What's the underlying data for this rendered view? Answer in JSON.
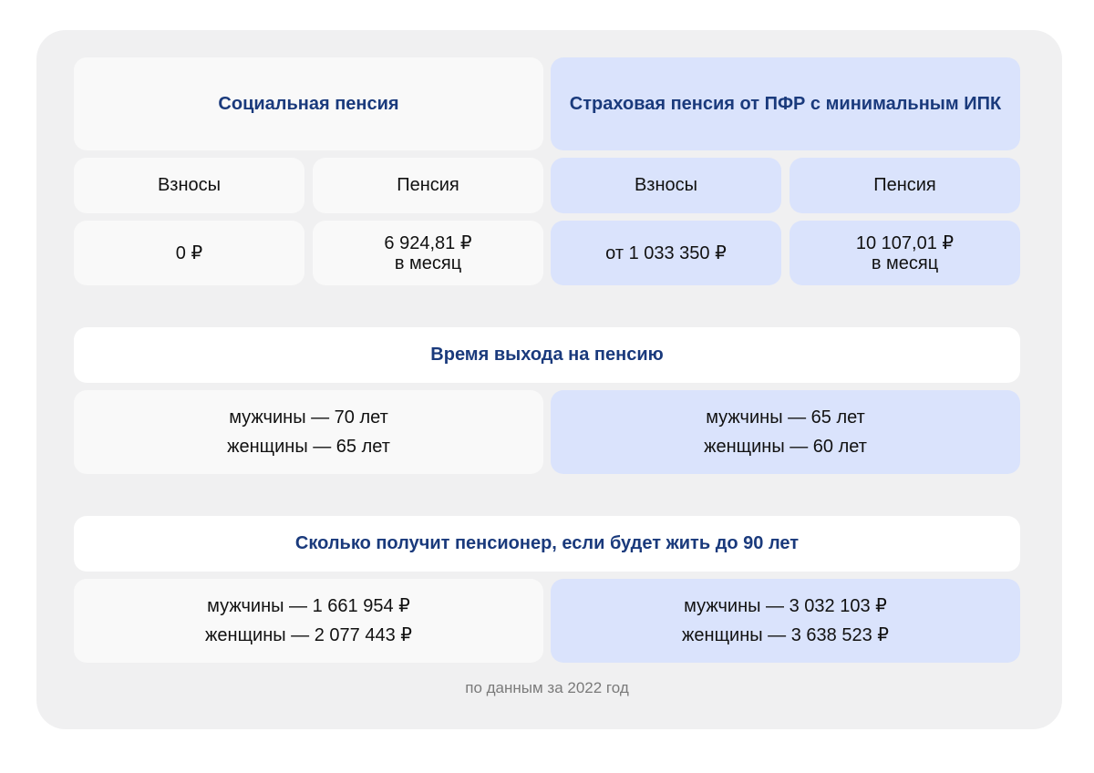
{
  "comparison": {
    "social": {
      "title": "Социальная пенсия",
      "contributions_label": "Взносы",
      "pension_label": "Пенсия",
      "contributions_value": "0 ₽",
      "pension_value": "6 924,81 ₽",
      "pension_period": "в месяц"
    },
    "insurance": {
      "title": "Страховая пенсия от ПФР с минимальным ИПК",
      "contributions_label": "Взносы",
      "pension_label": "Пенсия",
      "contributions_value": "от 1 033 350 ₽",
      "pension_value": "10 107,01 ₽",
      "pension_period": "в месяц"
    }
  },
  "retirement_age": {
    "title": "Время выхода на пенсию",
    "social": {
      "men": "мужчины — 70 лет",
      "women": "женщины — 65 лет"
    },
    "insurance": {
      "men": "мужчины — 65 лет",
      "women": "женщины — 60 лет"
    }
  },
  "total_received": {
    "title": "Сколько получит пенсионер, если будет жить до 90 лет",
    "social": {
      "men": "мужчины — 1 661 954 ₽",
      "women": "женщины — 2 077 443 ₽"
    },
    "insurance": {
      "men": "мужчины — 3 032 103 ₽",
      "women": "женщины — 3 638 523 ₽"
    }
  },
  "footnote": "по данным за 2022 год",
  "colors": {
    "heading": "#1a3a7c",
    "panel": "#f0f0f1",
    "social_cell": "#f9f9f9",
    "insurance_cell": "#dae3fc"
  }
}
